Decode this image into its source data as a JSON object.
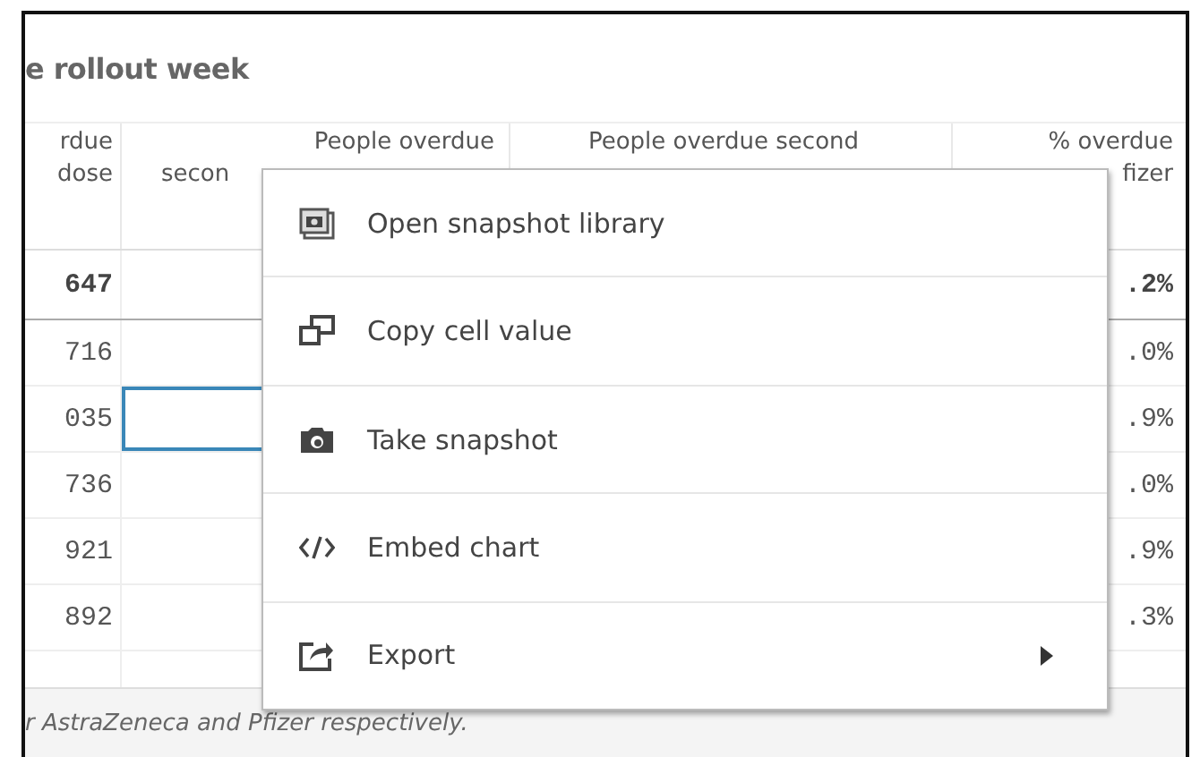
{
  "title": "e rollout week",
  "columns": [
    {
      "lines": [
        "rdue",
        "dose"
      ]
    },
    {
      "lines": [
        "People overdue",
        "secon"
      ]
    },
    {
      "lines": [
        "People overdue second"
      ]
    },
    {
      "lines": [
        "% overdue",
        "fizer"
      ]
    }
  ],
  "total_row": {
    "cells": [
      "647",
      "",
      "",
      ".2%"
    ]
  },
  "rows": [
    {
      "cells": [
        "716",
        "",
        "",
        ".0%"
      ],
      "selected": false
    },
    {
      "cells": [
        "035",
        "",
        "",
        ".9%"
      ],
      "selected": true
    },
    {
      "cells": [
        "736",
        "",
        "",
        ".0%"
      ],
      "selected": false
    },
    {
      "cells": [
        "921",
        "",
        "",
        ".9%"
      ],
      "selected": false
    },
    {
      "cells": [
        "892",
        "",
        "",
        ".3%"
      ],
      "selected": false
    }
  ],
  "footnote": "r AstraZeneca and Pfizer respectively.",
  "context_menu": [
    {
      "label": "Open snapshot library",
      "submenu": false
    },
    {
      "label": "Copy cell value",
      "submenu": false
    },
    {
      "label": "Take snapshot",
      "submenu": false
    },
    {
      "label": "Embed chart",
      "submenu": false
    },
    {
      "label": "Export",
      "submenu": true
    }
  ]
}
